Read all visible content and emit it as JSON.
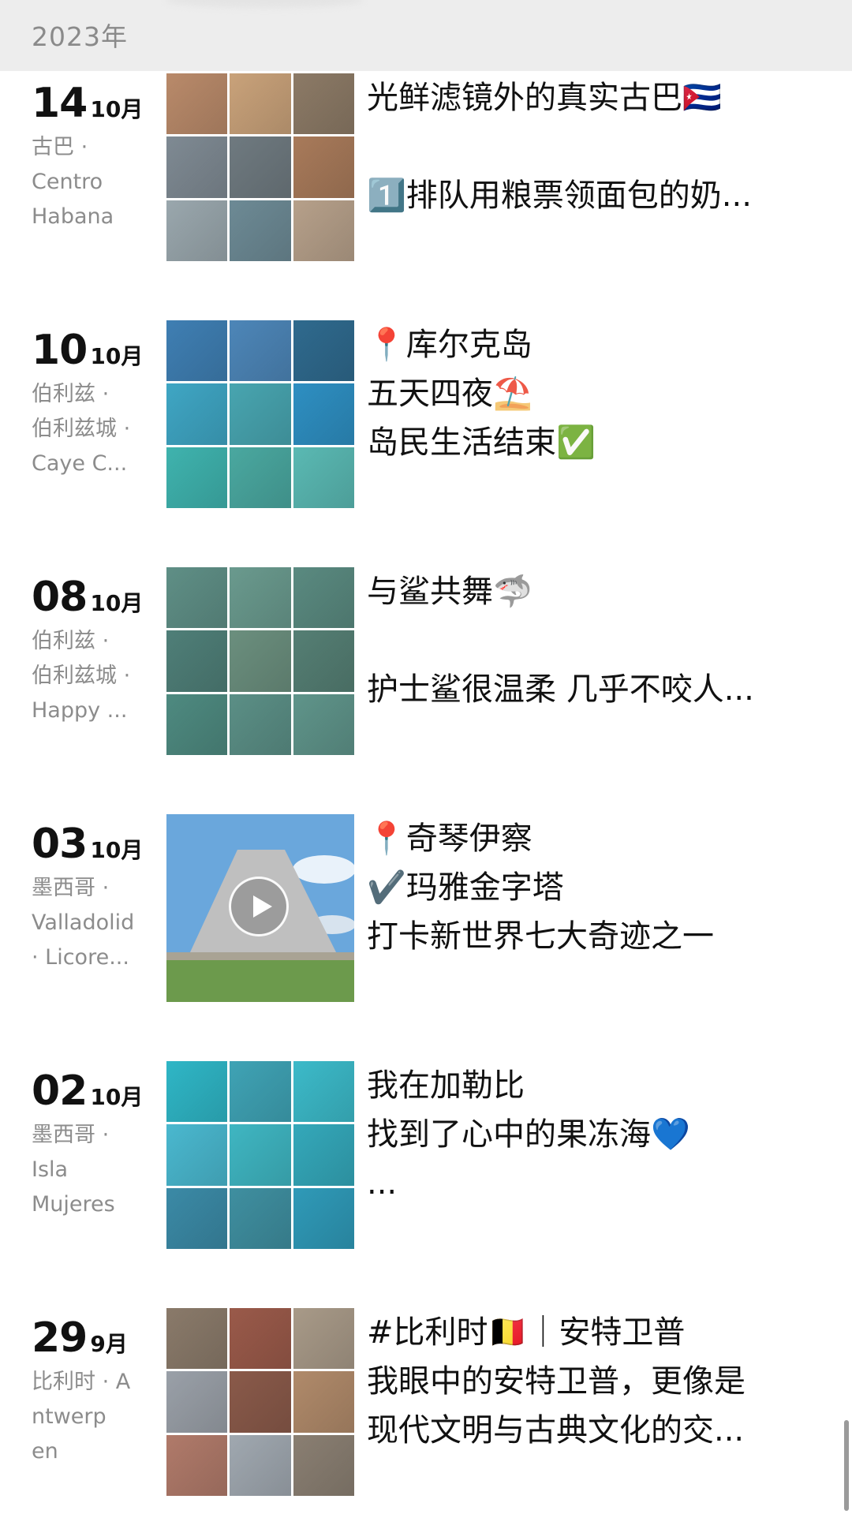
{
  "year_header": {
    "label": "2023年"
  },
  "posts": [
    {
      "day": "14",
      "month": "10月",
      "location_lines": [
        "古巴 ·",
        "Centro",
        "Habana"
      ],
      "caption_lines": [
        "光鲜滤镜外的真实古巴🇨🇺",
        "",
        "1️⃣排队用粮票领面包的奶..."
      ],
      "thumbnail_type": "grid",
      "thumbnail_colors": [
        "#b98a6a",
        "#c9a27a",
        "#8c7a66",
        "#7f8a93",
        "#6f7a80",
        "#a87a5a",
        "#9aa7ad",
        "#6d8a95",
        "#b6a08a"
      ]
    },
    {
      "day": "10",
      "month": "10月",
      "location_lines": [
        "伯利兹 ·",
        "伯利兹城 ·",
        " Caye C..."
      ],
      "caption_lines": [
        "📍库尔克岛",
        "五天四夜⛱️",
        "岛民生活结束✅"
      ],
      "thumbnail_type": "grid",
      "thumbnail_colors": [
        "#3f7fb3",
        "#4d86b8",
        "#2f6a8e",
        "#3fa6c4",
        "#48a5b0",
        "#2e8fc2",
        "#3fb3ae",
        "#4aa8a0",
        "#5ab9b3"
      ]
    },
    {
      "day": "08",
      "month": "10月",
      "location_lines": [
        "伯利兹 ·",
        "伯利兹城 ·",
        " Happy ..."
      ],
      "caption_lines": [
        "与鲨共舞🦈",
        "",
        "护士鲨很温柔 几乎不咬人..."
      ],
      "thumbnail_type": "grid",
      "thumbnail_colors": [
        "#5f8f86",
        "#6a9a8e",
        "#5a8a80",
        "#4f7f78",
        "#6b8f7e",
        "#557f74",
        "#4e8a80",
        "#5b8f86",
        "#5f948a"
      ]
    },
    {
      "day": "03",
      "month": "10月",
      "location_lines": [
        "墨西哥 ·",
        "Valladolid",
        "· Licore..."
      ],
      "caption_lines": [
        "📍奇琴伊察",
        "✔️玛雅金字塔",
        "打卡新世界七大奇迹之一"
      ],
      "thumbnail_type": "video",
      "thumbnail_colors": [
        "#6aa7dc",
        "#bfbfbf",
        "#6c9a4c"
      ]
    },
    {
      "day": "02",
      "month": "10月",
      "location_lines": [
        "墨西哥 ·",
        "Isla",
        "Mujeres"
      ],
      "caption_lines": [
        "我在加勒比",
        "找到了心中的果冻海💙",
        "..."
      ],
      "thumbnail_type": "grid",
      "thumbnail_colors": [
        "#2fb6c6",
        "#3fa3b5",
        "#3cbac9",
        "#4ab8cf",
        "#3fb6c2",
        "#34a8ba",
        "#3b8aa6",
        "#3f8fa0",
        "#2f9ab8"
      ]
    },
    {
      "day": "29",
      "month": "9月",
      "location_lines": [
        "比利时 · A",
        "ntwerp",
        "en"
      ],
      "caption_lines": [
        "#比利时🇧🇪｜安特卫普",
        "我眼中的安特卫普，更像是",
        "现代文明与古典文化的交..."
      ],
      "thumbnail_type": "grid",
      "thumbnail_colors": [
        "#8a7a6a",
        "#9a5a4a",
        "#a89a88",
        "#9aa0a8",
        "#8a5a4a",
        "#b08a6a",
        "#b07a6a",
        "#a0a8b0",
        "#8a7f72"
      ]
    }
  ]
}
